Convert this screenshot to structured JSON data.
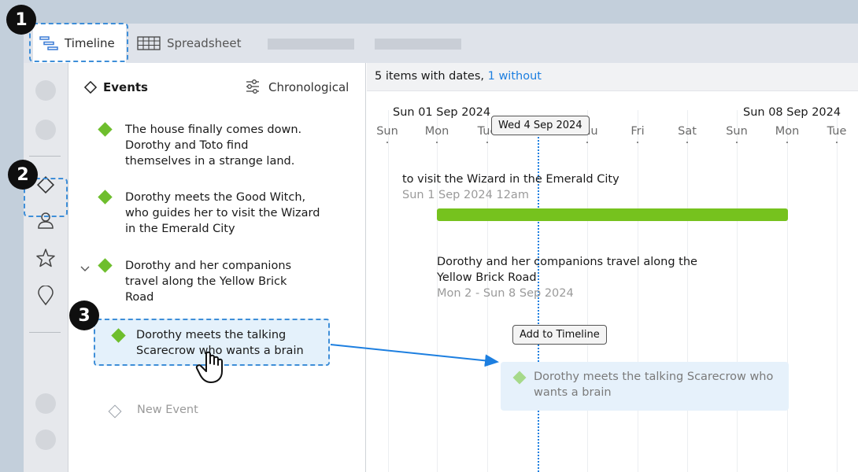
{
  "tabs": {
    "timeline": "Timeline",
    "spreadsheet": "Spreadsheet"
  },
  "events_panel": {
    "title": "Events",
    "sort_label": "Chronological",
    "items": [
      {
        "text": "The house finally comes down. Dorothy and Toto find themselves in a strange land."
      },
      {
        "text": "Dorothy meets the Good Witch, who guides her to visit the Wizard in the Emerald City"
      },
      {
        "text": "Dorothy and her companions travel along the Yellow Brick Road"
      },
      {
        "text": "Dorothy meets the talking Scarecrow who wants a brain"
      }
    ],
    "new_event": "New Event"
  },
  "timeline": {
    "summary_prefix": "5 items with dates,",
    "summary_link": "1 without",
    "date_left": "Sun 01 Sep 2024",
    "date_right": "Sun 08 Sep 2024",
    "today_tooltip": "Wed 4 Sep 2024",
    "days": [
      "Sun",
      "Mon",
      "Tue",
      "Wed",
      "Thu",
      "Fri",
      "Sat",
      "Sun",
      "Mon",
      "Tue"
    ],
    "entry1_text": "to visit the Wizard in the Emerald City",
    "entry1_date": "Sun 1 Sep 2024 12am",
    "entry2_line1": "Dorothy and her companions travel along the",
    "entry2_line2": "Yellow Brick Road",
    "entry2_date": "Mon 2 - Sun 8 Sep 2024",
    "add_tooltip": "Add to Timeline",
    "ghost_text": "Dorothy meets the talking Scarecrow who wants a brain"
  },
  "badges": [
    "1",
    "2",
    "3"
  ],
  "colors": {
    "accent": "#1d7fe0",
    "event_green": "#6ebe2d",
    "bar_green": "#76c21e",
    "highlight_border": "#3e8ed8"
  },
  "icons": [
    "timeline-icon",
    "spreadsheet-icon",
    "diamond-icon",
    "person-icon",
    "star-icon",
    "location-pin-icon",
    "filter-sliders-icon",
    "chevron-down-icon",
    "hand-cursor-icon"
  ]
}
